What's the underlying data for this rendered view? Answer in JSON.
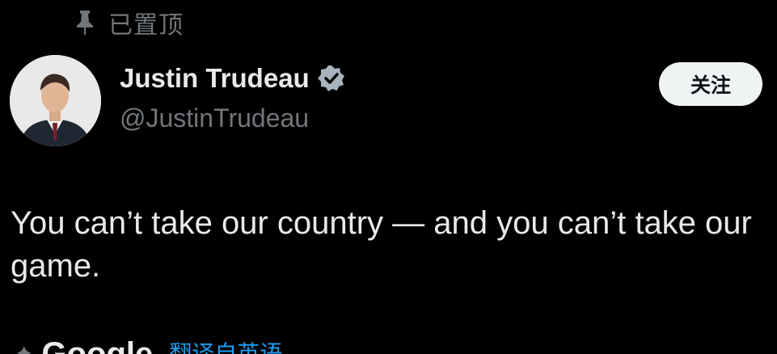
{
  "pinned": {
    "icon": "pin-icon",
    "label": "已置顶"
  },
  "author": {
    "avatar_icon": "avatar",
    "display_name": "Justin Trudeau",
    "verified_icon": "verified-badge-icon",
    "handle": "@JustinTrudeau"
  },
  "follow": {
    "label": "关注"
  },
  "tweet": {
    "text": "You can’t take our country — and you can’t take our game."
  },
  "footer": {
    "google_label": "Google",
    "translate_label": "翻译自英语"
  },
  "colors": {
    "background": "#000000",
    "text_primary": "#e7e9ea",
    "text_secondary": "#71767b",
    "verified": "#a8b3bd",
    "follow_bg": "#eff3f4",
    "link": "#1d9bf0"
  }
}
